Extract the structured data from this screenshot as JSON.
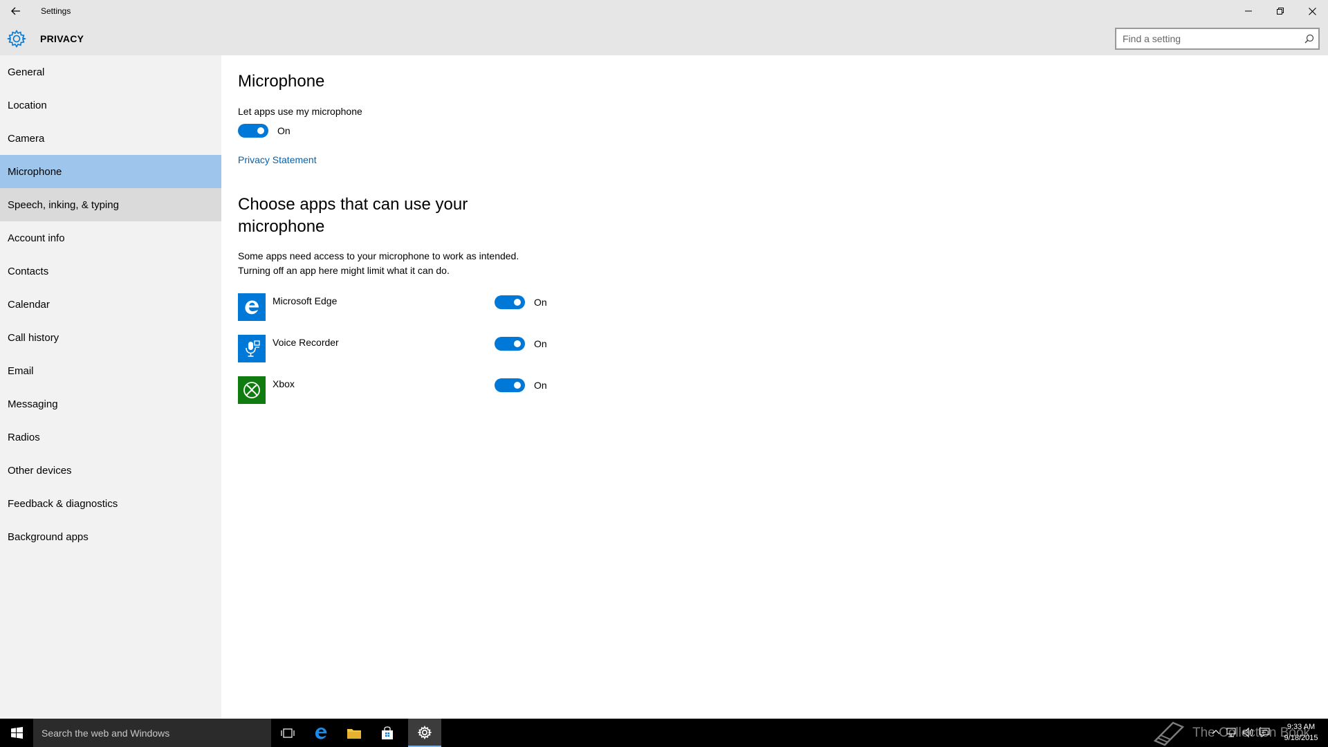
{
  "window": {
    "title": "Settings",
    "section": "PRIVACY"
  },
  "search": {
    "placeholder": "Find a setting"
  },
  "sidebar": {
    "items": [
      {
        "label": "General"
      },
      {
        "label": "Location"
      },
      {
        "label": "Camera"
      },
      {
        "label": "Microphone",
        "selected": true
      },
      {
        "label": "Speech, inking, & typing",
        "hovered": true
      },
      {
        "label": "Account info"
      },
      {
        "label": "Contacts"
      },
      {
        "label": "Calendar"
      },
      {
        "label": "Call history"
      },
      {
        "label": "Email"
      },
      {
        "label": "Messaging"
      },
      {
        "label": "Radios"
      },
      {
        "label": "Other devices"
      },
      {
        "label": "Feedback & diagnostics"
      },
      {
        "label": "Background apps"
      }
    ]
  },
  "main": {
    "title": "Microphone",
    "master_toggle": {
      "label": "Let apps use my microphone",
      "state": "On"
    },
    "privacy_link": "Privacy Statement",
    "apps_heading": "Choose apps that can use your microphone",
    "description_line1": "Some apps need access to your microphone to work as intended.",
    "description_line2": "Turning off an app here might limit what it can do.",
    "apps": [
      {
        "name": "Microsoft Edge",
        "state": "On",
        "icon": "edge-icon",
        "color": "#0078d7"
      },
      {
        "name": "Voice Recorder",
        "state": "On",
        "icon": "voice-recorder-icon",
        "color": "#0078d7"
      },
      {
        "name": "Xbox",
        "state": "On",
        "icon": "xbox-icon",
        "color": "#107c10"
      }
    ]
  },
  "taskbar": {
    "search_text": "Search the web and Windows",
    "watermark": "The Collection Book",
    "time": "9:33 AM",
    "date": "9/18/2015"
  },
  "colors": {
    "accent": "#0078d7",
    "selected_nav": "#9ec6ec",
    "chrome": "#e6e6e6",
    "sidebar": "#f2f2f2",
    "link": "#0063b1"
  }
}
